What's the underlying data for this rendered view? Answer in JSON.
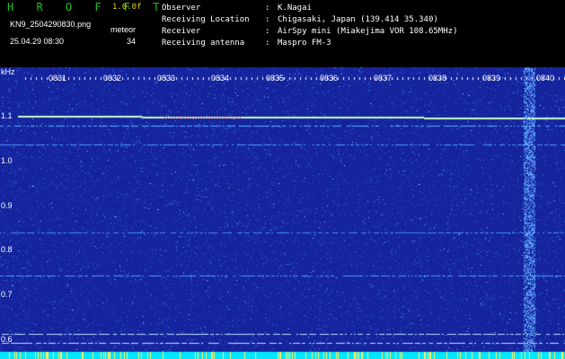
{
  "header": {
    "app_name": "H R O F F T",
    "version": "1.0.0f",
    "filename": "KN9_2504290830.png",
    "datetime": "25.04.29 08:30",
    "meteor_label": "meteor",
    "meteor_count": "34"
  },
  "info": [
    {
      "label": "Observer",
      "value": "K.Nagai"
    },
    {
      "label": "Receiving Location",
      "value": "Chigasaki, Japan (139.414 35.340)"
    },
    {
      "label": "Receiver",
      "value": "AirSpy mini (Miakejima VOR 108.65MHz)"
    },
    {
      "label": "Receiving antenna",
      "value": "Maspro FM-3"
    }
  ],
  "axis": {
    "unit": "kHz",
    "y_ticks": [
      "1.1",
      "1.0",
      "0.9",
      "0.8",
      "0.7",
      "0.6"
    ],
    "x_ticks": [
      "0831",
      "0832",
      "0833",
      "0834",
      "0835",
      "0836",
      "0837",
      "0838",
      "0839",
      "0840"
    ]
  },
  "colors": {
    "background": "#15239c",
    "noise": "#3c8cf0",
    "carrier": "#c8ffc8",
    "carrier_hot": "#ff6040",
    "bottom_band": "#00e8ff"
  }
}
